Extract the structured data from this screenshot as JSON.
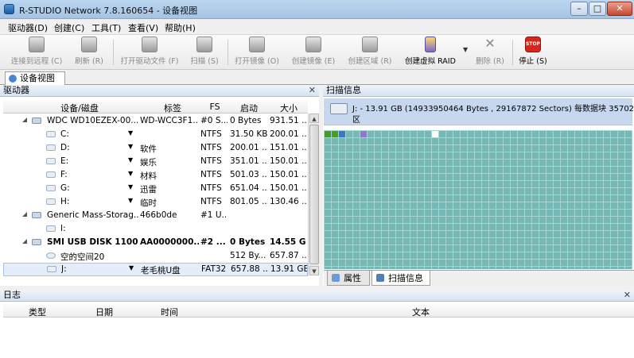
{
  "window": {
    "title": "R-STUDIO Network 7.8.160654 - 设备视图"
  },
  "menu": [
    {
      "label": "驱动器(D)"
    },
    {
      "label": "创建(C)"
    },
    {
      "label": "工具(T)"
    },
    {
      "label": "查看(V)"
    },
    {
      "label": "帮助(H)"
    }
  ],
  "toolbar": [
    {
      "label": "连接到远程 (C)",
      "icon": "connect-remote-icon",
      "enabled": false
    },
    {
      "label": "刷新 (R)",
      "icon": "refresh-icon",
      "enabled": false
    },
    {
      "label": "打开驱动文件 (F)",
      "icon": "open-drive-file-icon",
      "enabled": false
    },
    {
      "label": "扫描 (S)",
      "icon": "scan-icon",
      "enabled": false
    },
    {
      "label": "打开镜像 (O)",
      "icon": "open-image-icon",
      "enabled": false
    },
    {
      "label": "创建镜像 (E)",
      "icon": "create-image-icon",
      "enabled": false
    },
    {
      "label": "创建区域 (R)",
      "icon": "create-region-icon",
      "enabled": false
    },
    {
      "label": "创建虚拟 RAID",
      "icon": "virtual-raid-icon",
      "enabled": true
    },
    {
      "label": "删除 (R)",
      "icon": "delete-icon",
      "enabled": false
    },
    {
      "label": "停止 (S)",
      "icon": "stop-icon",
      "enabled": true
    }
  ],
  "tabs": {
    "main": "设备视图"
  },
  "drives_panel": {
    "title": "驱动器",
    "columns": [
      "设备/磁盘",
      "标签",
      "FS",
      "启动",
      "大小"
    ],
    "rows": [
      {
        "name": "WDC WD10EZEX-00...",
        "label": "WD-WCC3F1...",
        "fs": "#0 S...",
        "start": "0 Bytes",
        "size": "931.51 ..."
      },
      {
        "name": "C:",
        "label": "",
        "fs": "NTFS",
        "start": "31.50 KB",
        "size": "200.01 ..."
      },
      {
        "name": "D:",
        "label": "软件",
        "fs": "NTFS",
        "start": "200.01 ...",
        "size": "151.01 ..."
      },
      {
        "name": "E:",
        "label": "娱乐",
        "fs": "NTFS",
        "start": "351.01 ...",
        "size": "150.01 ..."
      },
      {
        "name": "F:",
        "label": "材料",
        "fs": "NTFS",
        "start": "501.03 ...",
        "size": "150.01 ..."
      },
      {
        "name": "G:",
        "label": "迅雷",
        "fs": "NTFS",
        "start": "651.04 ...",
        "size": "150.01 ..."
      },
      {
        "name": "H:",
        "label": "临时",
        "fs": "NTFS",
        "start": "801.05 ...",
        "size": "130.46 ..."
      },
      {
        "name": "Generic Mass-Storag...",
        "label": "466b0de",
        "fs": "#1 U...",
        "start": "",
        "size": ""
      },
      {
        "name": "I:",
        "label": "",
        "fs": "",
        "start": "",
        "size": ""
      },
      {
        "name": "SMI USB DISK 1100",
        "label": "AA0000000...",
        "fs": "#2 ...",
        "start": "0 Bytes",
        "size": "14.55 GB"
      },
      {
        "name": "空的空间20",
        "label": "",
        "fs": "",
        "start": "512 By...",
        "size": "657.87 ..."
      },
      {
        "name": "J:",
        "label": "老毛桃U盘",
        "fs": "FAT32",
        "start": "657.88 ...",
        "size": "13.91 GB"
      }
    ]
  },
  "scan_panel": {
    "title": "扫描信息",
    "info_line1": "J: - 13.91 GB (14933950464 Bytes , 29167872 Sectors) 每数据块 35702 扇",
    "info_line2": "区",
    "tab_properties": "属性",
    "tab_scan_info": "扫描信息"
  },
  "log_panel": {
    "title": "日志",
    "columns": [
      "类型",
      "日期",
      "时间",
      "文本"
    ]
  },
  "colors": {
    "scan_grid": "#76b8b3",
    "scan_line": "#a6d6d3",
    "selected_row": "#e4eefa",
    "header_blue": "#d6e3f2"
  }
}
